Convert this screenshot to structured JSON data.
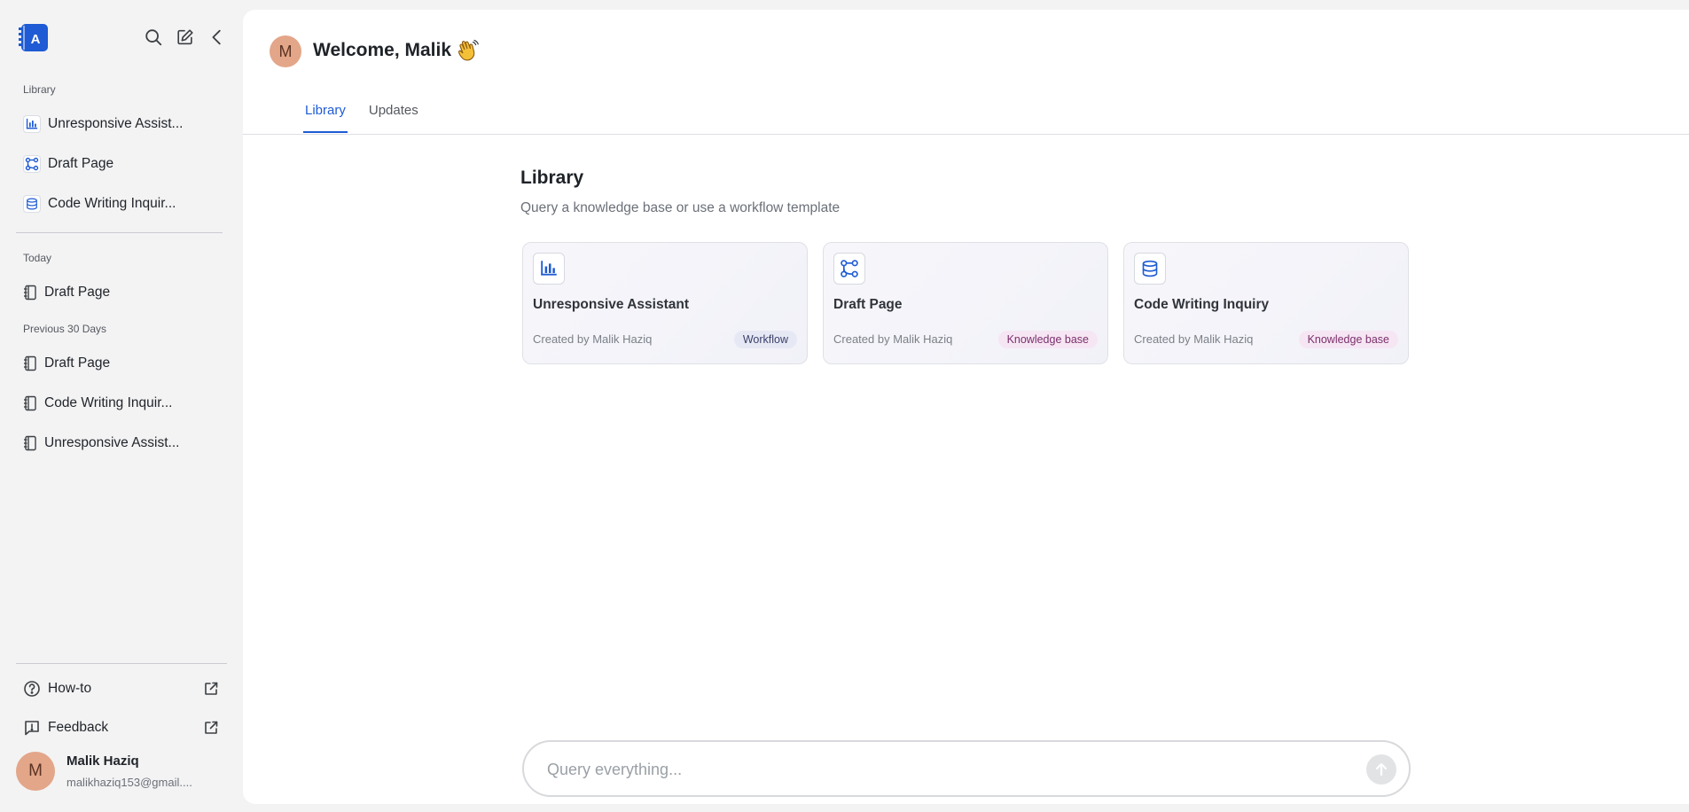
{
  "app": {
    "logo_letter": "A",
    "brand_color": "#1e5bd4"
  },
  "sidebar": {
    "library_label": "Library",
    "library_items": [
      {
        "label": "Unresponsive Assist...",
        "icon": "bar-chart-icon"
      },
      {
        "label": "Draft Page",
        "icon": "workflow-icon"
      },
      {
        "label": "Code Writing Inquir...",
        "icon": "database-icon"
      }
    ],
    "today_label": "Today",
    "today_items": [
      {
        "label": "Draft Page",
        "icon": "notebook-icon"
      }
    ],
    "previous_label": "Previous 30 Days",
    "previous_items": [
      {
        "label": "Draft Page",
        "icon": "notebook-icon"
      },
      {
        "label": "Code Writing Inquir...",
        "icon": "notebook-icon"
      },
      {
        "label": "Unresponsive Assist...",
        "icon": "notebook-icon"
      }
    ],
    "footer": {
      "howto_label": "How-to",
      "feedback_label": "Feedback"
    },
    "user": {
      "initial": "M",
      "name": "Malik Haziq",
      "email": "malikhaziq153@gmail...."
    }
  },
  "header": {
    "avatar_initial": "M",
    "welcome_text": "Welcome, Malik",
    "tabs": [
      {
        "label": "Library",
        "active": true
      },
      {
        "label": "Updates",
        "active": false
      }
    ]
  },
  "library": {
    "title": "Library",
    "subtitle": "Query a knowledge base or use a workflow template",
    "cards": [
      {
        "title": "Unresponsive Assistant",
        "created_by": "Created by Malik Haziq",
        "badge": "Workflow",
        "icon": "bar-chart-icon"
      },
      {
        "title": "Draft Page",
        "created_by": "Created by Malik Haziq",
        "badge": "Knowledge base",
        "icon": "workflow-icon"
      },
      {
        "title": "Code Writing Inquiry",
        "created_by": "Created by Malik Haziq",
        "badge": "Knowledge base",
        "icon": "database-icon"
      }
    ]
  },
  "query": {
    "placeholder": "Query everything..."
  }
}
